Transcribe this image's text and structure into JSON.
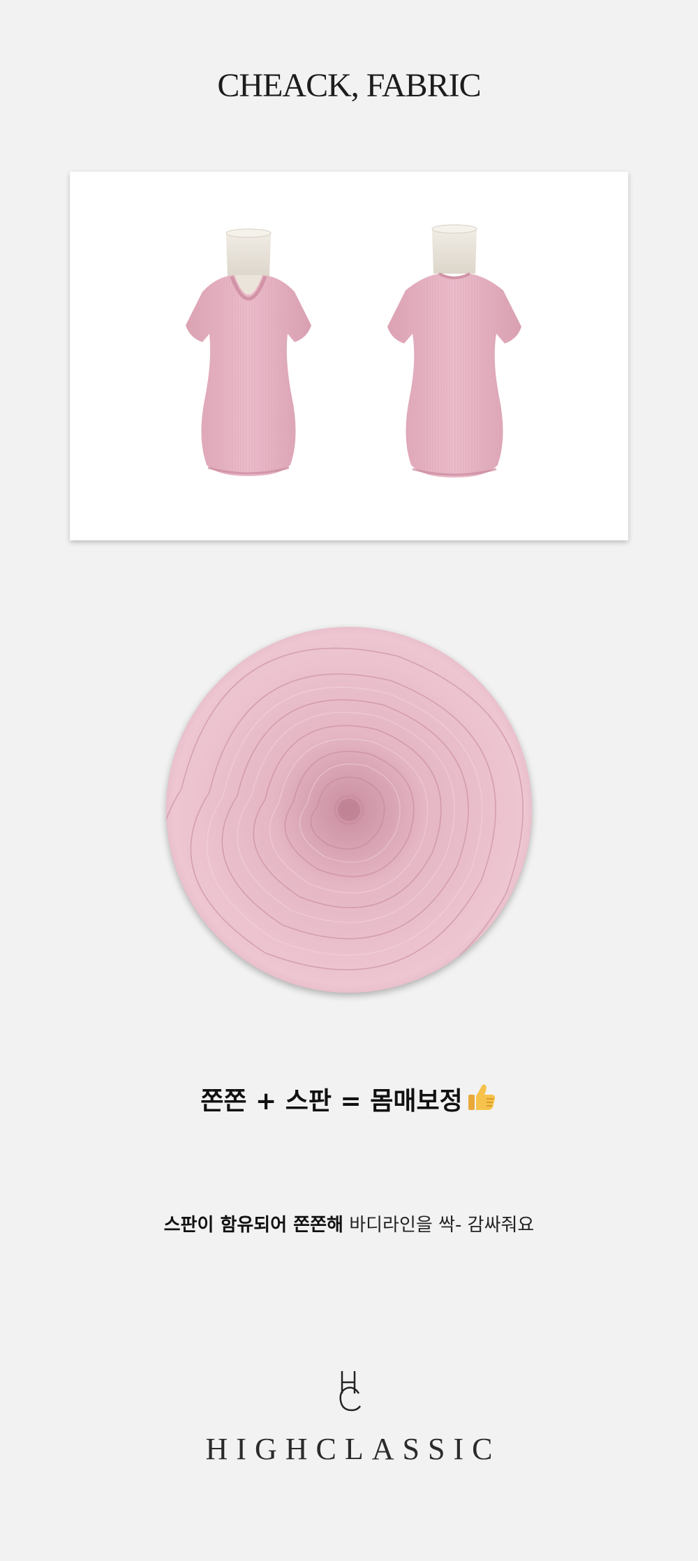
{
  "section": {
    "title": "CHEACK, FABRIC"
  },
  "product": {
    "views": [
      "front-view",
      "back-view"
    ],
    "shirt_color": "#e6b3c1",
    "mannequin_color": "#ece7df"
  },
  "fabric": {
    "color": "#e8bcc8",
    "icon": "fabric-swirl"
  },
  "headline": {
    "text": "쫀쫀 + 스판 = 몸매보정",
    "emoji": "thumbs-up-icon"
  },
  "subline": {
    "strong": "스판이 함유되어 쫀쫀해",
    "rest": " 바디라인을 싹- 감싸줘요"
  },
  "brand": {
    "name": "HIGHCLASSIC",
    "monogram": "HC-logo"
  },
  "colors": {
    "background": "#f2f2f2",
    "card": "#ffffff",
    "text": "#1a1a1a"
  }
}
